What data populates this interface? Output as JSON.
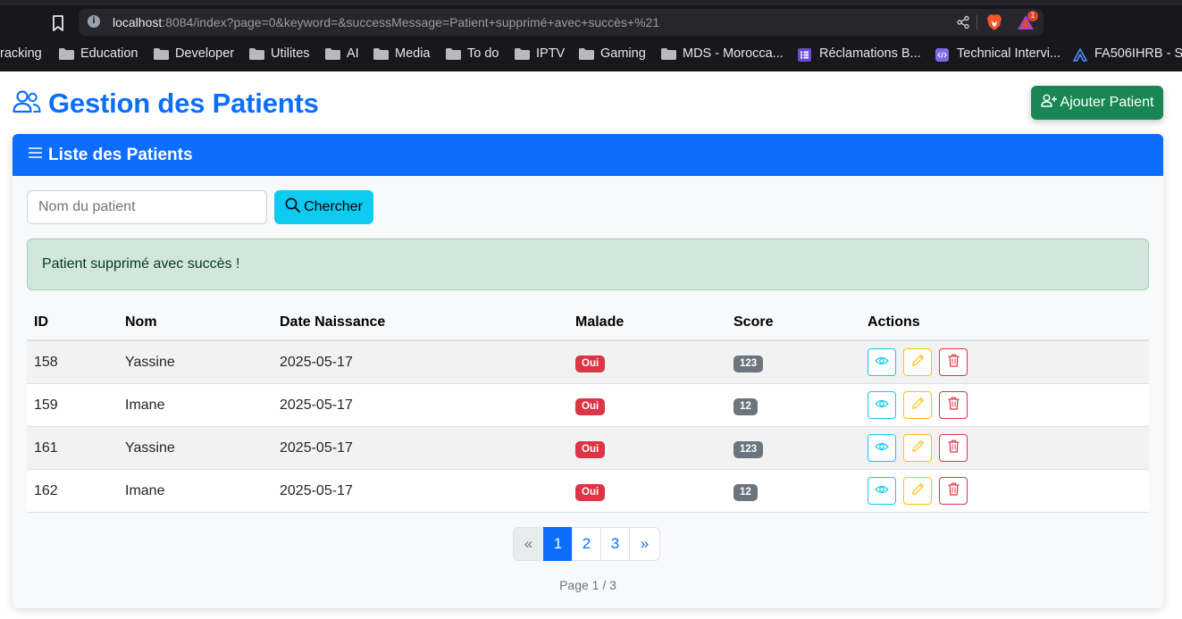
{
  "browser": {
    "url_host": "localhost",
    "url_rest": ":8084/index?page=0&keyword=&successMessage=Patient+supprimé+avec+succès+%21",
    "rewards_count": "1",
    "bookmarks": [
      {
        "label": "racking",
        "icon": "none"
      },
      {
        "label": "Education",
        "icon": "folder-icon"
      },
      {
        "label": "Developer",
        "icon": "folder-icon"
      },
      {
        "label": "Utilites",
        "icon": "folder-icon"
      },
      {
        "label": "AI",
        "icon": "folder-icon"
      },
      {
        "label": "Media",
        "icon": "folder-icon"
      },
      {
        "label": "To do",
        "icon": "folder-icon"
      },
      {
        "label": "IPTV",
        "icon": "folder-icon"
      },
      {
        "label": "Gaming",
        "icon": "folder-icon"
      },
      {
        "label": "MDS - Morocca...",
        "icon": "folder-icon"
      },
      {
        "label": "Réclamations B...",
        "icon": "list-icon"
      },
      {
        "label": "Technical Intervi...",
        "icon": "code-icon"
      },
      {
        "label": "FA506IHRB - S",
        "icon": "triangle-logo-icon"
      }
    ]
  },
  "header": {
    "title": "Gestion des Patients",
    "title_icon": "people-icon",
    "add_button_label": "Ajouter Patient",
    "add_button_icon": "person-plus-icon"
  },
  "card": {
    "title": "Liste des Patients",
    "title_icon": "list-icon"
  },
  "search": {
    "placeholder": "Nom du patient",
    "value": "",
    "button_label": "Chercher",
    "button_icon": "search-icon"
  },
  "alert": {
    "message": "Patient supprimé avec succès !"
  },
  "table": {
    "columns": [
      "ID",
      "Nom",
      "Date Naissance",
      "Malade",
      "Score",
      "Actions"
    ],
    "rows": [
      {
        "id": "158",
        "nom": "Yassine",
        "date": "2025-05-17",
        "malade": "Oui",
        "score": "123"
      },
      {
        "id": "159",
        "nom": "Imane",
        "date": "2025-05-17",
        "malade": "Oui",
        "score": "12"
      },
      {
        "id": "161",
        "nom": "Yassine",
        "date": "2025-05-17",
        "malade": "Oui",
        "score": "123"
      },
      {
        "id": "162",
        "nom": "Imane",
        "date": "2025-05-17",
        "malade": "Oui",
        "score": "12"
      }
    ],
    "action_icons": [
      "eye-icon",
      "pencil-icon",
      "trash-icon"
    ]
  },
  "pagination": {
    "prev": "«",
    "pages": [
      "1",
      "2",
      "3"
    ],
    "active": "1",
    "next": "»",
    "info": "Page 1 / 3"
  },
  "colors": {
    "primary": "#0d6efd",
    "success": "#198754",
    "info": "#0dcaf0",
    "warning": "#ffc107",
    "danger": "#dc3545",
    "secondary": "#6c757d",
    "alert_bg": "#d1e7dd"
  }
}
